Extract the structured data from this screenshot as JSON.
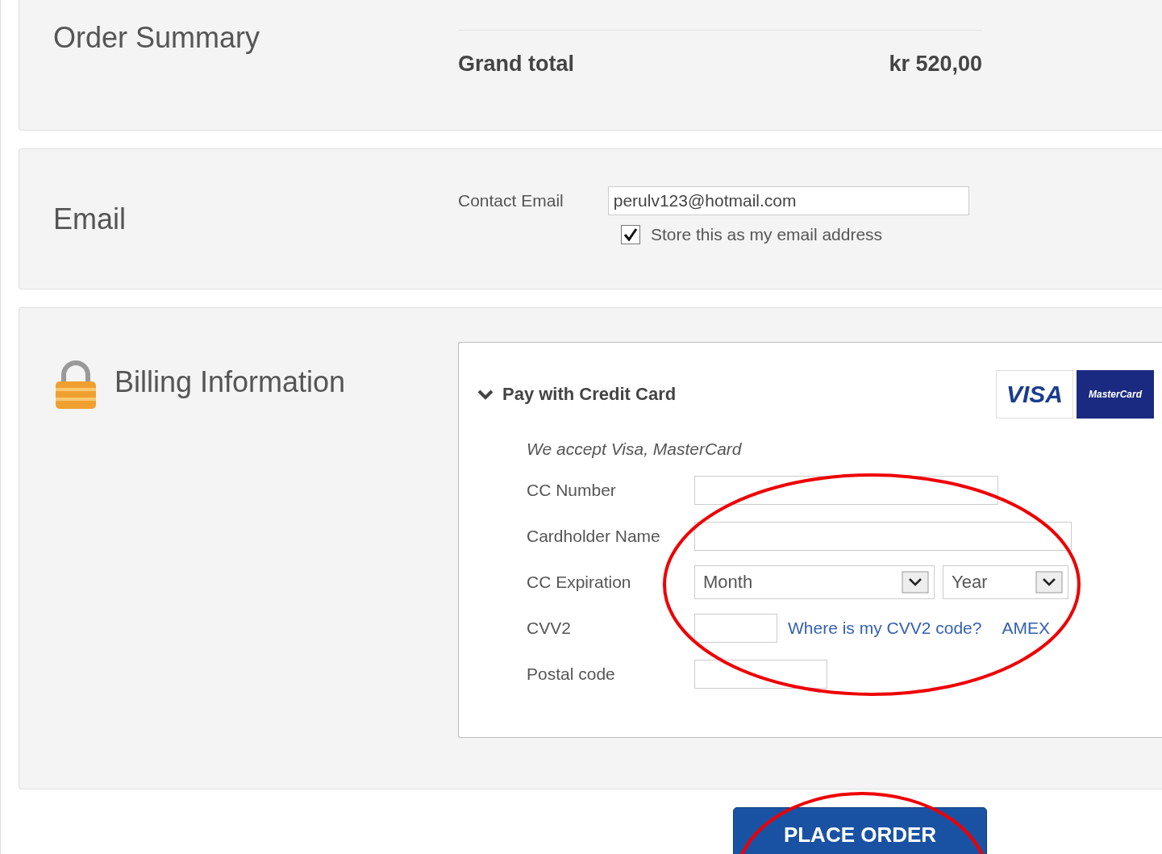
{
  "order_summary": {
    "title": "Order Summary",
    "total_label": "Grand total",
    "total_value": "kr 520,00"
  },
  "email": {
    "title": "Email",
    "field_label": "Contact Email",
    "value": "perulv123@hotmail.com",
    "store_label": "Store this as my email address",
    "store_checked": true
  },
  "billing": {
    "title": "Billing Information",
    "method": {
      "title": "Pay with Credit Card",
      "expanded": true,
      "logos": [
        {
          "kind": "visa",
          "label": "VISA"
        },
        {
          "kind": "mastercard",
          "label": "MasterCard"
        }
      ],
      "note": "We accept Visa, MasterCard",
      "fields": [
        {
          "kind": "text",
          "label": "CC Number"
        },
        {
          "kind": "text",
          "label": "Cardholder Name"
        },
        {
          "kind": "expiry",
          "label": "CC Expiration",
          "month": "Month",
          "year": "Year"
        },
        {
          "kind": "cvv",
          "label": "CVV2",
          "link": "Where is my CVV2 code?",
          "link_2": "AMEX"
        },
        {
          "kind": "text",
          "label": "Postal code"
        }
      ]
    }
  },
  "place_order": "PLACE ORDER",
  "annotations": [
    {
      "kind": "ellipse"
    },
    {
      "kind": "ellipse"
    }
  ]
}
